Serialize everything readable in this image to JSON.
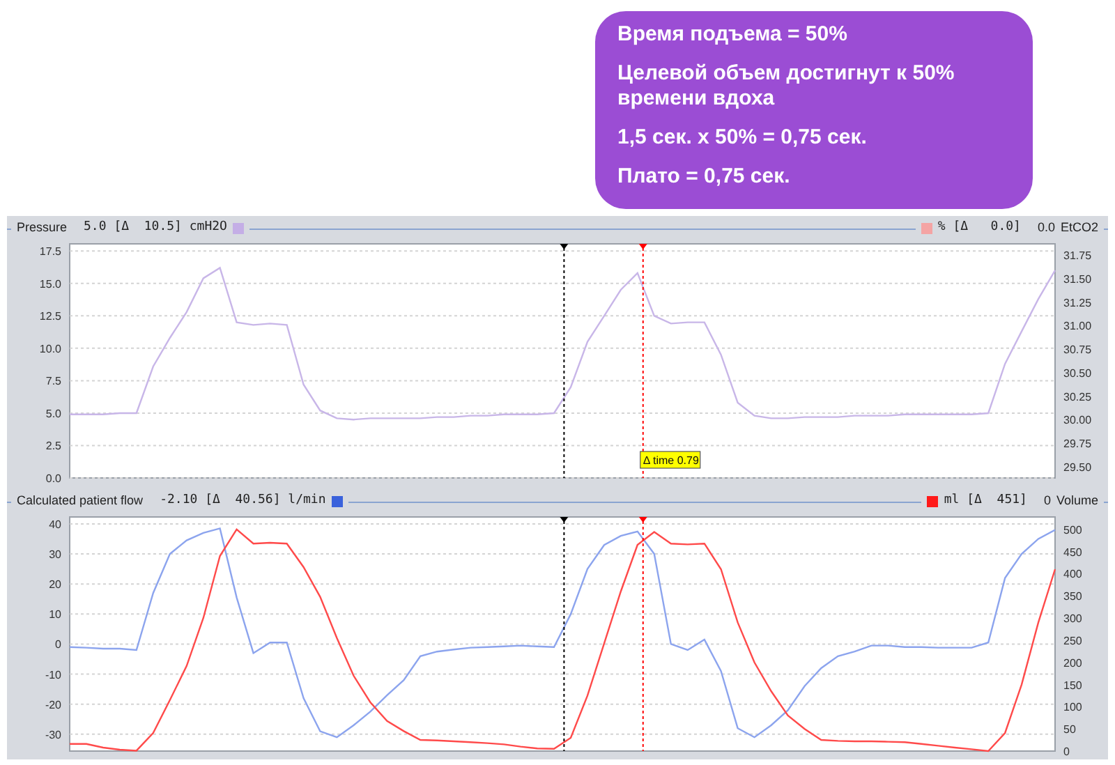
{
  "callout": {
    "lines": [
      "Время подъема = 50%",
      "Целевой объем достигнут к 50% времени вдоха",
      "1,5 сек. x 50% = 0,75 сек.",
      "Плато = 0,75 сек."
    ]
  },
  "charts": [
    {
      "header": {
        "left": {
          "reading": "5.0 [Δ  10.5] cmH2O",
          "color": "#c4aee6"
        },
        "right": {
          "reading": "% [Δ   0.0]",
          "value": "0.0",
          "name": "EtCO2",
          "color": "#f4a4a4"
        }
      },
      "chart_data": {
        "type": "line",
        "ylim": [
          0,
          18.05
        ],
        "yticks": [
          {
            "value": 0,
            "label": "0.0"
          },
          {
            "value": 2.5,
            "label": "2.5"
          },
          {
            "value": 5,
            "label": "5.0"
          },
          {
            "value": 7.5,
            "label": "7.5"
          },
          {
            "value": 10,
            "label": "10.0"
          },
          {
            "value": 12.5,
            "label": "12.5"
          },
          {
            "value": 15,
            "label": "15.0"
          },
          {
            "value": 17.5,
            "label": "17.5"
          }
        ],
        "y2lim": [
          29.38,
          31.87
        ],
        "y2ticks": [
          {
            "value": 29.5,
            "label": "29.50"
          },
          {
            "value": 29.75,
            "label": "29.75"
          },
          {
            "value": 30,
            "label": "30.00"
          },
          {
            "value": 30.25,
            "label": "30.25"
          },
          {
            "value": 30.5,
            "label": "30.50"
          },
          {
            "value": 30.75,
            "label": "30.75"
          },
          {
            "value": 31,
            "label": "31.00"
          },
          {
            "value": 31.25,
            "label": "31.25"
          },
          {
            "value": 31.5,
            "label": "31.50"
          },
          {
            "value": 31.75,
            "label": "31.75"
          }
        ],
        "series": [
          {
            "name": "Pressure",
            "color": "#c8b6e8",
            "values": [
              4.9,
              4.9,
              4.9,
              5.0,
              5.0,
              8.6,
              10.8,
              12.8,
              15.4,
              16.2,
              12.0,
              11.8,
              11.9,
              11.8,
              7.2,
              5.2,
              4.6,
              4.5,
              4.6,
              4.6,
              4.6,
              4.6,
              4.7,
              4.7,
              4.8,
              4.8,
              4.9,
              4.9,
              4.9,
              5.0,
              7.0,
              10.5,
              12.5,
              14.5,
              15.8,
              12.5,
              11.9,
              12.0,
              12.0,
              9.5,
              5.8,
              4.8,
              4.6,
              4.6,
              4.7,
              4.7,
              4.7,
              4.8,
              4.8,
              4.8,
              4.9,
              4.9,
              4.9,
              4.9,
              4.9,
              5.0,
              8.8,
              11.3,
              13.8,
              16.0
            ]
          }
        ],
        "grid": true,
        "annotations": [
          "Δ time 0.79"
        ]
      }
    },
    {
      "header": {
        "left": {
          "reading": "-2.10 [Δ  40.56] l/min",
          "color": "#3a62dc"
        },
        "right": {
          "reading": "ml [Δ  451]",
          "value": "0",
          "color": "#ff1a1a"
        }
      },
      "chart_data": {
        "type": "line",
        "ylim": [
          -35.6,
          42.3
        ],
        "yticks": [
          {
            "value": -30,
            "label": "-30"
          },
          {
            "value": -20,
            "label": "-20"
          },
          {
            "value": -10,
            "label": "-10"
          },
          {
            "value": 0,
            "label": "0"
          },
          {
            "value": 10,
            "label": "10"
          },
          {
            "value": 20,
            "label": "20"
          },
          {
            "value": 30,
            "label": "30"
          },
          {
            "value": 40,
            "label": "40"
          }
        ],
        "y2lim": [
          0,
          528
        ],
        "y2ticks": [
          0,
          50,
          100,
          150,
          200,
          250,
          300,
          350,
          400,
          450,
          500
        ],
        "series": [
          {
            "name": "Calculated patient flow",
            "color": "#8ca4ee",
            "values": [
              -1,
              -1.2,
              -1.5,
              -1.5,
              -2,
              17,
              30,
              34.5,
              37,
              38.5,
              15.5,
              -3,
              0.5,
              0.5,
              -18,
              -29,
              -31,
              -27,
              -22.5,
              -17,
              -12,
              -4,
              -2.5,
              -1.8,
              -1.2,
              -1,
              -0.8,
              -0.5,
              -0.8,
              -1,
              10,
              25,
              33,
              36,
              37.5,
              30,
              0,
              -2,
              1.5,
              -9,
              -28,
              -31,
              -27,
              -22,
              -14,
              -8,
              -4,
              -2.5,
              -0.5,
              -0.5,
              -1,
              -1,
              -1.2,
              -1.2,
              -1.2,
              0.5,
              22,
              30,
              35,
              38
            ]
          },
          {
            "name": "Volume",
            "color": "#ff4a4a",
            "axis": "y2",
            "values": [
              16,
              16,
              8,
              3,
              1,
              41,
              115,
              192,
              300,
              440,
              500,
              468,
              470,
              468,
              415,
              348,
              255,
              170,
              110,
              68,
              45,
              25,
              24,
              22,
              20,
              18,
              15,
              10,
              6,
              5,
              30,
              125,
              243,
              360,
              465,
              494,
              468,
              466,
              468,
              410,
              290,
              200,
              135,
              80,
              50,
              25,
              23,
              22,
              22,
              21,
              20,
              16,
              12,
              8,
              4,
              0,
              41,
              150,
              290,
              410
            ]
          }
        ],
        "grid": true
      }
    }
  ]
}
